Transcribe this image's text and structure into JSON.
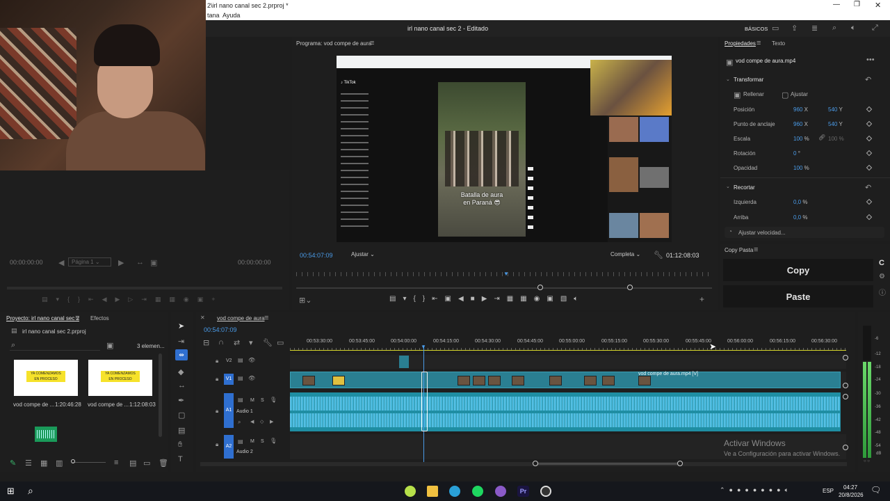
{
  "window": {
    "title": "2\\irl nano canal sec 2.prproj *",
    "menu": [
      "tana",
      "Ayuda"
    ]
  },
  "header": {
    "document_title": "irl nano canal sec 2 - Editado",
    "workspace": "BÁSICOS"
  },
  "source_monitor": {
    "timecode_in": "00:00:00:00",
    "timecode_out": "00:00:00:00",
    "page_select": "Página 1"
  },
  "program_monitor": {
    "tab": "Programa: vod compe de aura",
    "timecode": "00:54:07:09",
    "fit": "Ajustar",
    "quality": "Completa",
    "duration": "01:12:08:03",
    "video_caption_line1": "Batalla de aura",
    "video_caption_line2": "en Paraná 😎"
  },
  "properties": {
    "tab_active": "Propiedades",
    "tab_other": "Texto",
    "clip_name": "vod compe de aura.mp4",
    "transform": {
      "title": "Transformar",
      "fill": "Rellenar",
      "fit": "Ajustar",
      "rows": [
        {
          "label": "Posición",
          "x": "960",
          "x_unit": "X",
          "y": "540",
          "y_unit": "Y"
        },
        {
          "label": "Punto de anclaje",
          "x": "960",
          "x_unit": "X",
          "y": "540",
          "y_unit": "Y"
        },
        {
          "label": "Escala",
          "x": "100",
          "x_unit": "%",
          "y": "100",
          "y_unit": "%"
        },
        {
          "label": "Rotación",
          "x": "0",
          "x_unit": "°",
          "y": "",
          "y_unit": ""
        },
        {
          "label": "Opacidad",
          "x": "100",
          "x_unit": "%",
          "y": "",
          "y_unit": ""
        }
      ]
    },
    "crop": {
      "title": "Recortar",
      "rows": [
        {
          "label": "Izquierda",
          "x": "0,0",
          "x_unit": "%"
        },
        {
          "label": "Arriba",
          "x": "0,0",
          "x_unit": "%"
        }
      ]
    },
    "speed_button": "Ajustar velocidad..."
  },
  "copy_paste": {
    "title": "Copy Pasta",
    "copy": "Copy",
    "paste": "Paste"
  },
  "project": {
    "tab": "Proyecto: irl nano canal sec 2",
    "tab2": "Efectos",
    "file": "irl nano canal sec 2.prproj",
    "count": "3 elemen...",
    "items": [
      {
        "name": "vod compe de ...",
        "duration": "1:20:46:28",
        "thumb_text1": "YA COMENZAMOS",
        "thumb_text2": "EN PROCESO"
      },
      {
        "name": "vod compe de ...",
        "duration": "1:12:08:03",
        "thumb_text1": "YA COMENZAMOS",
        "thumb_text2": "EN PROCESO"
      }
    ]
  },
  "timeline": {
    "tab": "vod compe de aura",
    "timecode": "00:54:07:09",
    "ruler": [
      "00:53:30:00",
      "00:53:45:00",
      "00:54:00:00",
      "00:54:15:00",
      "00:54:30:00",
      "00:54:45:00",
      "00:55:00:00",
      "00:55:15:00",
      "00:55:30:00",
      "00:55:45:00",
      "00:56:00:00",
      "00:56:15:00",
      "00:56:30:00"
    ],
    "tracks": {
      "v2": "V2",
      "v1": "V1",
      "a1": "A1",
      "a1_name": "Audio 1",
      "a2": "A2",
      "a2_name": "Audio 2"
    },
    "clip_label": "vod compe de aura.mp4 [V]"
  },
  "meters": {
    "scale": [
      "-6",
      "-12",
      "-18",
      "-24",
      "-30",
      "-36",
      "-42",
      "-48",
      "-54",
      "dB"
    ]
  },
  "watermark": {
    "line1": "Activar Windows",
    "line2": "Ve a Configuración para activar Windows."
  },
  "taskbar": {
    "lang": "ESP",
    "time": "04:27",
    "date": "20/8/2026"
  }
}
